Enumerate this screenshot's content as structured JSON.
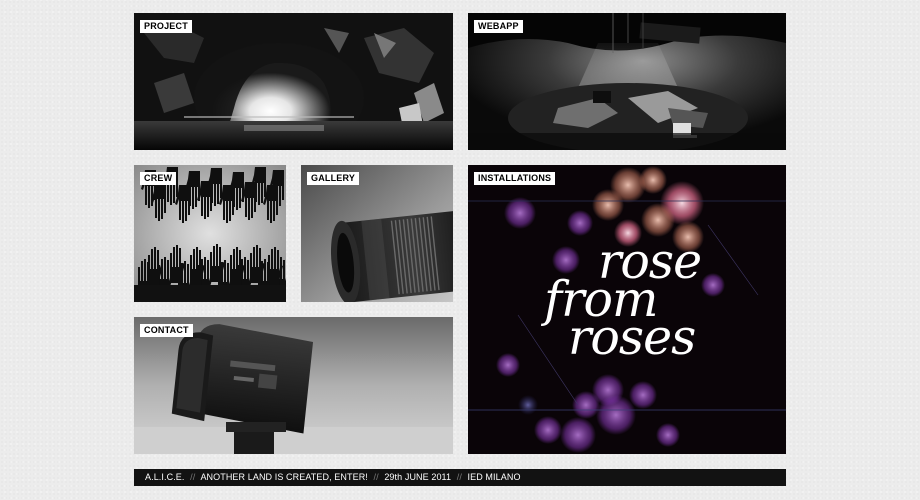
{
  "tiles": {
    "project": {
      "label": "PROJECT"
    },
    "webapp": {
      "label": "WEBAPP"
    },
    "crew": {
      "label": "CREW"
    },
    "gallery": {
      "label": "GALLERY"
    },
    "installations": {
      "label": "INSTALLATIONS",
      "poster": {
        "line1": "rose",
        "line2": "from",
        "line3": "roses",
        "colors": {
          "bokeh_pink": "#ff7aa0",
          "bokeh_purple": "#b85ce0",
          "bokeh_peach": "#ffb59a",
          "background": "#0a0408"
        }
      }
    },
    "contact": {
      "label": "CONTACT"
    }
  },
  "footer": {
    "part1": "A.L.I.C.E.",
    "part2": "ANOTHER LAND IS CREATED, ENTER!",
    "part3": "29th JUNE 2011",
    "part4": "IED MILANO",
    "separator": "//"
  }
}
